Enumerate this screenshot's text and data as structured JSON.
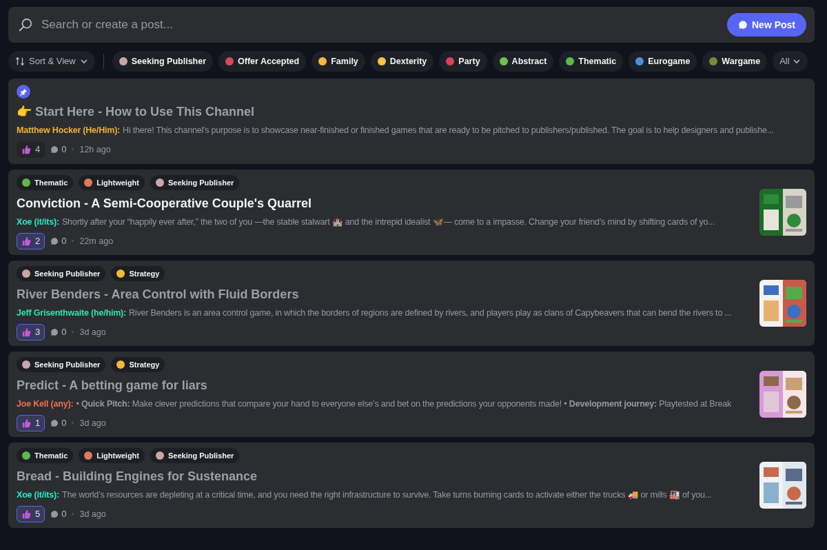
{
  "search": {
    "placeholder": "Search or create a post..."
  },
  "new_post_button": {
    "label": "New Post"
  },
  "sort_button": {
    "label": "Sort & View"
  },
  "filter_tags": [
    {
      "label": "Seeking Publisher",
      "color": "#c9a6a6"
    },
    {
      "label": "Offer Accepted",
      "color": "#d24b5a"
    },
    {
      "label": "Family",
      "color": "#f5b938"
    },
    {
      "label": "Dexterity",
      "color": "#f5c542"
    },
    {
      "label": "Party",
      "color": "#e0405a"
    },
    {
      "label": "Abstract",
      "color": "#6cc24a"
    },
    {
      "label": "Thematic",
      "color": "#5fb84a"
    },
    {
      "label": "Eurogame",
      "color": "#4a90d9"
    },
    {
      "label": "Wargame",
      "color": "#7a8a3a"
    }
  ],
  "all_button": {
    "label": "All"
  },
  "posts": [
    {
      "pinned": true,
      "unread": false,
      "title": "👉 Start Here - How to Use This Channel",
      "author": {
        "name": "Matthew Hocker (He/Him):",
        "color": "#f0b232"
      },
      "excerpt": "Hi there! This channel's purpose is to showcase near-finished or finished games that are ready to be pitched to publishers/published. The goal is to help designers and publishe...",
      "reactions": "4",
      "reacted": false,
      "comments": "0",
      "time": "12h ago"
    },
    {
      "pinned": false,
      "unread": true,
      "tags": [
        {
          "label": "Thematic",
          "color": "#5fb84a"
        },
        {
          "label": "Lightweight",
          "color": "#e07a5a"
        },
        {
          "label": "Seeking Publisher",
          "color": "#c9a6a6"
        }
      ],
      "title": "Conviction - A Semi-Cooperative Couple's Quarrel",
      "author": {
        "name": "Xoe (it/its):",
        "color": "#2ee6c4"
      },
      "excerpt": "Shortly after your “happily ever after,” the two of you —the stable stalwart 🏰 and the intrepid idealist 🦋— come to a impasse. Change your friend’s mind by shifting cards of yo...",
      "reactions": "2",
      "reacted": true,
      "comments": "0",
      "time": "22m ago",
      "thumbnail": {
        "kind": "picture"
      }
    },
    {
      "pinned": false,
      "unread": false,
      "tags": [
        {
          "label": "Seeking Publisher",
          "color": "#c9a6a6"
        },
        {
          "label": "Strategy",
          "color": "#f5b938"
        }
      ],
      "title": "River Benders - Area Control with Fluid Borders",
      "author": {
        "name": "Jeff Grisenthwaite (he/him):",
        "color": "#2ee6a8"
      },
      "excerpt": "River Benders is an area control game, in which the borders of regions are defined by rivers, and players play as clans of Capybeavers that can bend the rivers to ...",
      "reactions": "3",
      "reacted": true,
      "comments": "0",
      "time": "3d ago",
      "thumbnail": {
        "kind": "picture"
      }
    },
    {
      "pinned": false,
      "unread": false,
      "tags": [
        {
          "label": "Seeking Publisher",
          "color": "#c9a6a6"
        },
        {
          "label": "Strategy",
          "color": "#f5b938"
        }
      ],
      "title": "Predict - A betting game for liars",
      "author": {
        "name": "Joe Kell (any):",
        "color": "#f0704a"
      },
      "excerpt": "• **Quick Pitch:** Make clever predictions that compare your hand to everyone else’s and bet on the predictions your opponents made!  • **Development journey:** Playtested at Break",
      "reactions": "1",
      "reacted": true,
      "comments": "0",
      "time": "3d ago",
      "thumbnail": {
        "kind": "picture"
      }
    },
    {
      "pinned": false,
      "unread": false,
      "tags": [
        {
          "label": "Thematic",
          "color": "#5fb84a"
        },
        {
          "label": "Lightweight",
          "color": "#e07a5a"
        },
        {
          "label": "Seeking Publisher",
          "color": "#c9a6a6"
        }
      ],
      "title": "Bread - Building Engines for Sustenance",
      "author": {
        "name": "Xoe (it/its):",
        "color": "#2ee6c4"
      },
      "excerpt": "The world’s resources are depleting at a critical time, and you need the right infrastructure to survive. Take turns burning cards to activate either the trucks 🚚 or mills 🏭 of you...",
      "reactions": "5",
      "reacted": true,
      "comments": "0",
      "time": "3d ago",
      "thumbnail": {
        "kind": "picture"
      }
    }
  ]
}
